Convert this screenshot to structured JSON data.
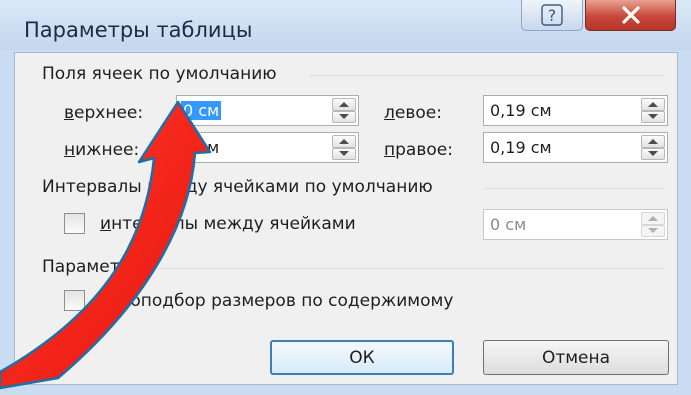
{
  "window": {
    "title": "Параметры таблицы",
    "help_glyph": "?",
    "close_glyph": "X"
  },
  "cell_margins": {
    "group_title": "Поля ячеек по умолчанию",
    "top": {
      "label_u": "в",
      "label_rest": "ерхнее:",
      "value": "0 см"
    },
    "bottom": {
      "label_u": "н",
      "label_rest": "ижнее:",
      "value": "0 см"
    },
    "left": {
      "label_u": "л",
      "label_rest": "евое:",
      "value": "0,19 см"
    },
    "right": {
      "label_u": "п",
      "label_rest": "равое:",
      "value": "0,19 см"
    }
  },
  "cell_spacing": {
    "group_title": "Интервалы между ячейками по умолчанию",
    "checkbox_label_u": "и",
    "checkbox_label_rest": "нтервалы между ячейками",
    "checked": false,
    "value": "0 см",
    "enabled": false
  },
  "options": {
    "group_title": "Параметры",
    "checkbox_label_u": "а",
    "checkbox_label_rest": "втоподбор размеров по содержимому",
    "checked": false
  },
  "buttons": {
    "ok": "ОК",
    "cancel": "Отмена"
  },
  "annotation": {
    "color": "#e8130d",
    "shape": "curved-arrow",
    "points_to": "top-margin-input"
  }
}
